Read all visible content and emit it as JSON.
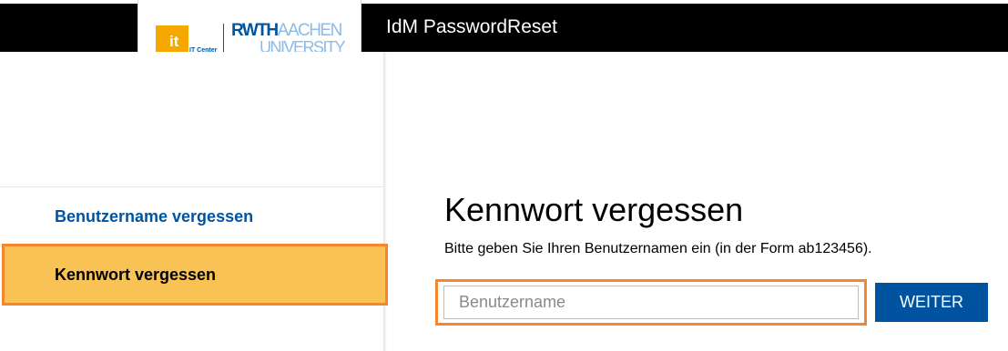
{
  "header": {
    "title": "IdM PasswordReset",
    "background_color": "#000000"
  },
  "logo": {
    "it_mark": "it",
    "it_subtitle": "IT Center",
    "rwth_text": "RWTH",
    "aachen_text": "AACHEN",
    "university_text": "UNIVERSITY",
    "colors": {
      "it": "#f5a800",
      "rwth_blue": "#00549f",
      "light_blue": "#8ebae5"
    }
  },
  "sidebar": {
    "items": [
      {
        "label": "Benutzername vergessen",
        "active": false
      },
      {
        "label": "Kennwort vergessen",
        "active": true
      }
    ],
    "active_color": "#f8c254",
    "highlight_border": "#f5862b"
  },
  "main": {
    "heading": "Kennwort vergessen",
    "hint": "Bitte geben Sie Ihren Benutzernamen ein (in der Form ab123456).",
    "username_input": {
      "value": "",
      "placeholder": "Benutzername"
    },
    "submit_label": "WEITER",
    "button_color": "#00549f"
  }
}
